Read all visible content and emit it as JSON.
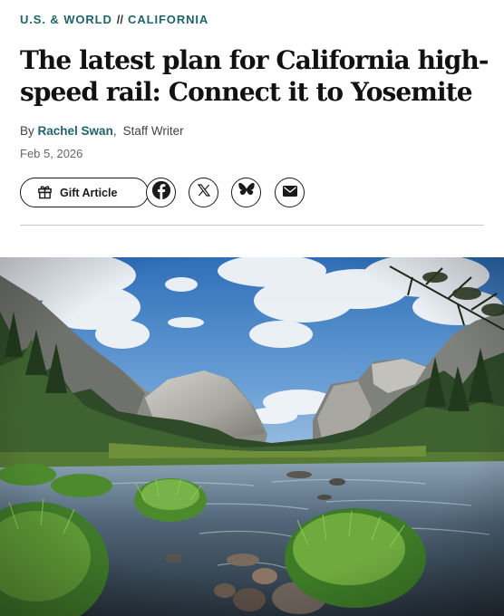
{
  "article": {
    "breadcrumb": {
      "section": "U.S. & WORLD",
      "separator": "//",
      "subsection": "CALIFORNIA"
    },
    "headline": "The latest plan for California high-speed rail: Connect it to Yosemite",
    "byline": {
      "prefix": "By",
      "author": "Rachel Swan",
      "role": "Staff Writer"
    },
    "date": "Feb 5, 2026"
  },
  "share": {
    "gift_label": "Gift Article",
    "icons": [
      "gift-icon",
      "facebook-icon",
      "x-icon",
      "bluesky-icon",
      "email-icon"
    ]
  },
  "hero": {
    "scene": "Yosemite Valley with El Capitan, Merced River and grass tussocks"
  },
  "colors": {
    "accent": "#1f6469",
    "text": "#111111",
    "divider": "#c8c8c8"
  }
}
